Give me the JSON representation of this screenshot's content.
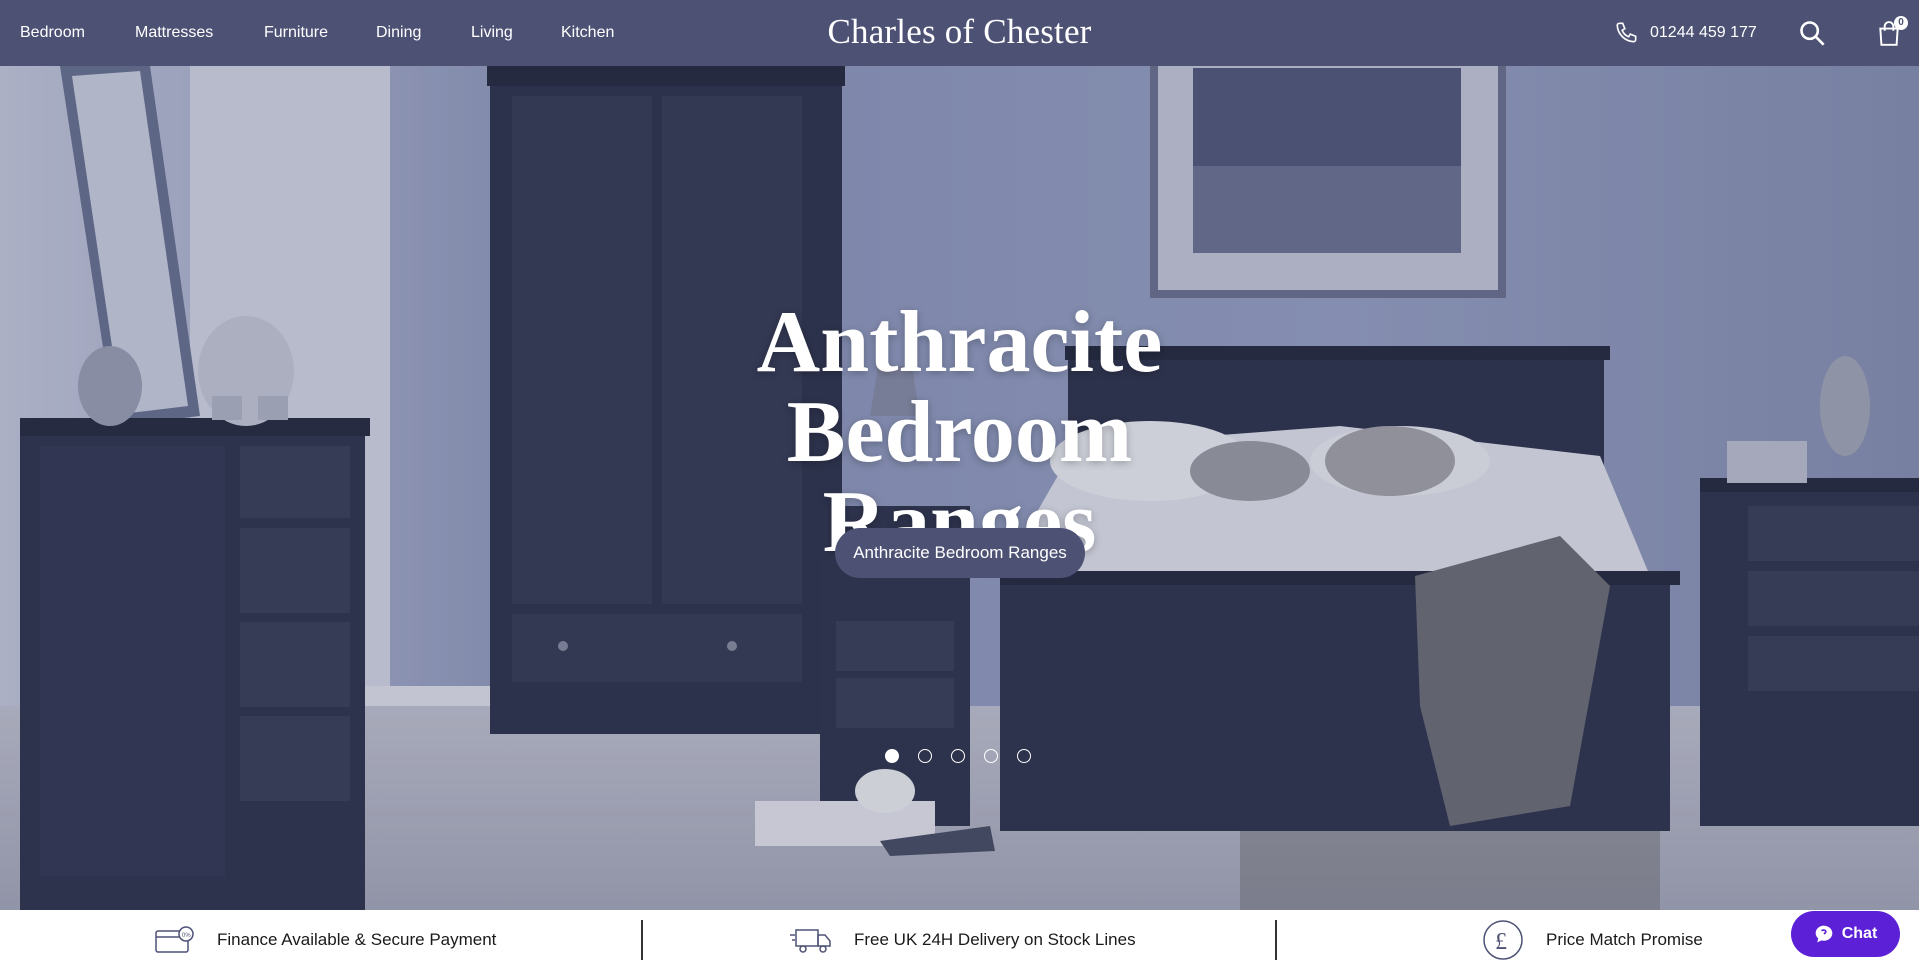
{
  "nav": {
    "items": [
      "Bedroom",
      "Mattresses",
      "Furniture",
      "Dining",
      "Living",
      "Kitchen"
    ]
  },
  "brand": {
    "name": "Charles of Chester"
  },
  "header": {
    "phone": "01244 459 177",
    "cart_count": "0",
    "icons": [
      "phone-icon",
      "search-icon",
      "cart-icon"
    ]
  },
  "hero": {
    "title_line1": "Anthracite Bedroom",
    "title_line2": "Ranges",
    "cta_label": "Anthracite Bedroom Ranges",
    "slide_count": 5,
    "active_slide": 1
  },
  "usp": {
    "finance": "Finance Available & Secure Payment",
    "delivery": "Free UK 24H Delivery on Stock Lines",
    "price_match": "Price Match Promise"
  },
  "chat": {
    "label": "Chat"
  },
  "colors": {
    "header_bg": "#4d5275",
    "chat_bg": "#5c21d6",
    "wall": "#8f98b8",
    "furniture": "#30354d"
  }
}
